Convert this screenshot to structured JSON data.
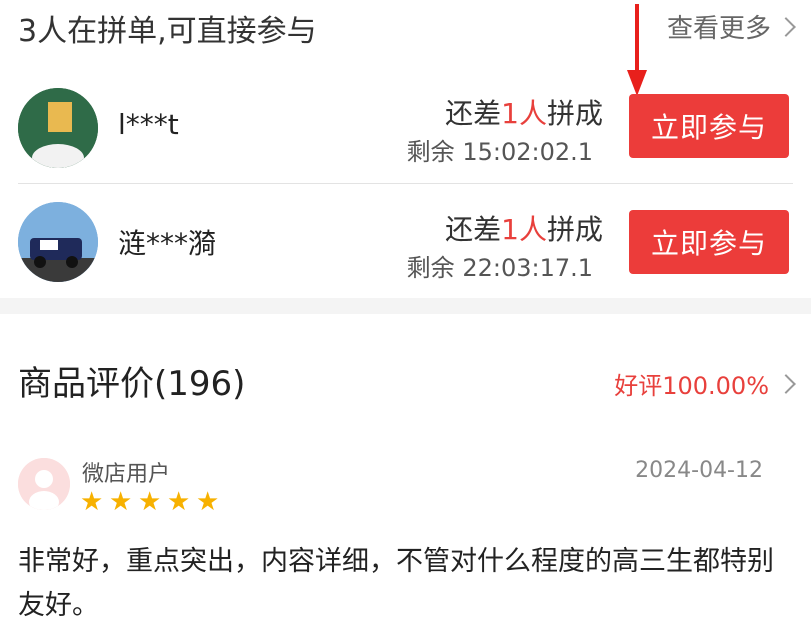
{
  "group_buy": {
    "title": "3人在拼单,可直接参与",
    "see_more": "查看更多",
    "rows": [
      {
        "username": "l***t",
        "need_prefix": "还差",
        "need_count": "1人",
        "need_suffix": "拼成",
        "remaining_label": "剩余",
        "remaining_time": "15:02:02.1",
        "join_label": "立即参与"
      },
      {
        "username": "涟***漪",
        "need_prefix": "还差",
        "need_count": "1人",
        "need_suffix": "拼成",
        "remaining_label": "剩余",
        "remaining_time": "22:03:17.1",
        "join_label": "立即参与"
      }
    ]
  },
  "reviews": {
    "title": "商品评价(196)",
    "good_rate": "好评100.00%",
    "items": [
      {
        "user": "微店用户",
        "date": "2024-04-12",
        "rating": 5,
        "text": "非常好，重点突出，内容详细，不管对什么程度的高三生都特别友好。"
      }
    ]
  },
  "colors": {
    "accent_red": "#ec3c3a",
    "star_yellow": "#f7b100"
  }
}
